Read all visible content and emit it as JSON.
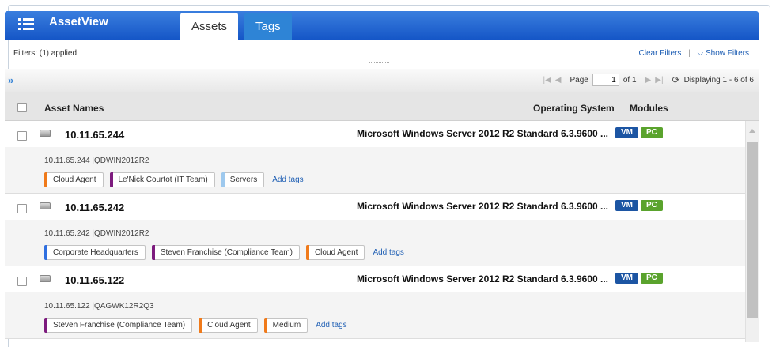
{
  "app": {
    "title": "AssetView"
  },
  "tabs": [
    {
      "label": "Assets",
      "active": true
    },
    {
      "label": "Tags",
      "active": false
    }
  ],
  "filters": {
    "prefix": "Filters: (",
    "count": "1",
    "suffix": ") applied",
    "clear_label": "Clear Filters",
    "separator": "|",
    "show_label": "Show Filters"
  },
  "pager": {
    "page_label": "Page",
    "page_value": "1",
    "of_label": "of 1",
    "displaying": "Displaying 1 - 6 of 6"
  },
  "columns": {
    "name": "Asset Names",
    "os": "Operating System",
    "modules": "Modules"
  },
  "colors": {
    "header_blue": "#1556c7",
    "vm_badge": "#1c55a3",
    "pc_badge": "#5aa32d",
    "link": "#1f5fb4"
  },
  "assets": [
    {
      "ip": "10.11.65.244",
      "os": "Microsoft Windows Server 2012 R2 Standard 6.3.9600 ...",
      "modules": [
        "VM",
        "PC"
      ],
      "subinfo": "10.11.65.244 |QDWIN2012R2",
      "tags": [
        {
          "label": "Cloud Agent",
          "color": "#f07a1a"
        },
        {
          "label": "Le'Nick Courtot (IT Team)",
          "color": "#7d1b7e"
        },
        {
          "label": "Servers",
          "color": "#9ec9ee"
        }
      ],
      "add_tags": "Add tags"
    },
    {
      "ip": "10.11.65.242",
      "os": "Microsoft Windows Server 2012 R2 Standard 6.3.9600 ...",
      "modules": [
        "VM",
        "PC"
      ],
      "subinfo": "10.11.65.242 |QDWIN2012R2",
      "tags": [
        {
          "label": "Corporate Headquarters",
          "color": "#2f6fe0"
        },
        {
          "label": "Steven Franchise (Compliance Team)",
          "color": "#7d1b7e"
        },
        {
          "label": "Cloud Agent",
          "color": "#f07a1a"
        }
      ],
      "add_tags": "Add tags"
    },
    {
      "ip": "10.11.65.122",
      "os": "Microsoft Windows Server 2012 R2 Standard 6.3.9600 ...",
      "modules": [
        "VM",
        "PC"
      ],
      "subinfo": "10.11.65.122 |QAGWK12R2Q3",
      "tags": [
        {
          "label": "Steven Franchise (Compliance Team)",
          "color": "#7d1b7e"
        },
        {
          "label": "Cloud Agent",
          "color": "#f07a1a"
        },
        {
          "label": "Medium",
          "color": "#f07a1a"
        }
      ],
      "add_tags": "Add tags"
    }
  ]
}
